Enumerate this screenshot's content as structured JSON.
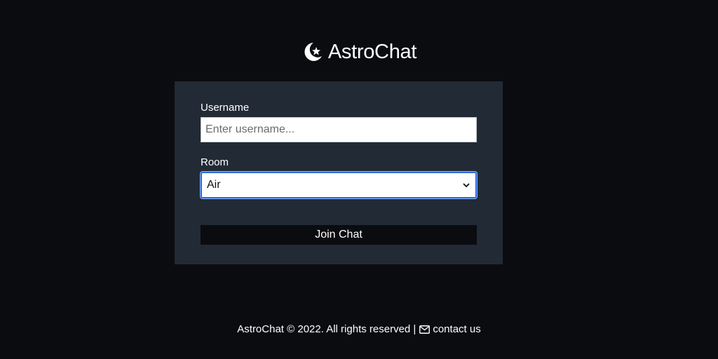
{
  "app": {
    "brand_name": "AstroChat",
    "brand_icon": "crescent-star-icon"
  },
  "form": {
    "username_label": "Username",
    "username_placeholder": "Enter username...",
    "username_value": "",
    "room_label": "Room",
    "room_selected": "Air",
    "join_label": "Join Chat"
  },
  "footer": {
    "copyright": "AstroChat © 2022. All rights reserved |",
    "contact_icon": "envelope-icon",
    "contact_label": "contact us"
  },
  "colors": {
    "background": "#0b0c10",
    "card": "#222a36",
    "focus_ring": "#2b6bdc",
    "text": "#ffffff"
  }
}
